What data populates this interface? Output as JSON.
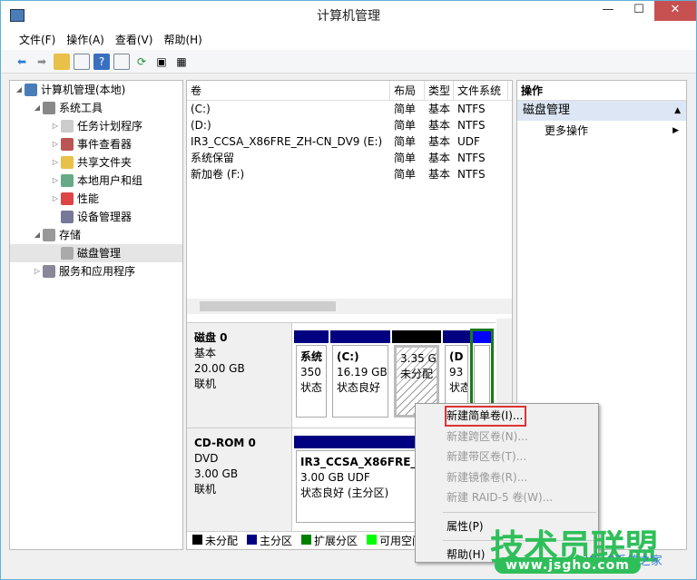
{
  "window": {
    "title": "计算机管理",
    "min": "—",
    "max": "☐",
    "close": "✕"
  },
  "menu": [
    "文件(F)",
    "操作(A)",
    "查看(V)",
    "帮助(H)"
  ],
  "tree": [
    {
      "label": "计算机管理(本地)",
      "level": 0,
      "tw": "◢",
      "color": "#4a7db8"
    },
    {
      "label": "系统工具",
      "level": 1,
      "tw": "◢",
      "color": "#888"
    },
    {
      "label": "任务计划程序",
      "level": 2,
      "tw": "▷",
      "color": "#ccc"
    },
    {
      "label": "事件查看器",
      "level": 2,
      "tw": "▷",
      "color": "#b55"
    },
    {
      "label": "共享文件夹",
      "level": 2,
      "tw": "▷",
      "color": "#e8c04a"
    },
    {
      "label": "本地用户和组",
      "level": 2,
      "tw": "▷",
      "color": "#6a8"
    },
    {
      "label": "性能",
      "level": 2,
      "tw": "▷",
      "color": "#d44"
    },
    {
      "label": "设备管理器",
      "level": 2,
      "tw": "",
      "color": "#779"
    },
    {
      "label": "存储",
      "level": 1,
      "tw": "◢",
      "color": "#999"
    },
    {
      "label": "磁盘管理",
      "level": 2,
      "tw": "",
      "color": "#aaa",
      "selected": true
    },
    {
      "label": "服务和应用程序",
      "level": 1,
      "tw": "▷",
      "color": "#889"
    }
  ],
  "volumes": {
    "headers": [
      "卷",
      "布局",
      "类型",
      "文件系统"
    ],
    "rows": [
      [
        "(C:)",
        "简单",
        "基本",
        "NTFS"
      ],
      [
        "(D:)",
        "简单",
        "基本",
        "NTFS"
      ],
      [
        "IR3_CCSA_X86FRE_ZH-CN_DV9 (E:)",
        "简单",
        "基本",
        "UDF"
      ],
      [
        "系统保留",
        "简单",
        "基本",
        "NTFS"
      ],
      [
        "新加卷 (F:)",
        "简单",
        "基本",
        "NTFS"
      ]
    ]
  },
  "disk0": {
    "name": "磁盘 0",
    "type": "基本",
    "size": "20.00 GB",
    "status": "联机",
    "parts": [
      {
        "l1": "系统",
        "l2": "350",
        "l3": "状态",
        "color": "#000080"
      },
      {
        "l1": "(C:)",
        "l2": "16.19 GB",
        "l3": "状态良好",
        "color": "#000080"
      },
      {
        "l1": "",
        "l2": "3.35 GB",
        "l3": "未分配",
        "color": "#000000"
      },
      {
        "l1": "(D",
        "l2": "93",
        "l3": "状态",
        "color": "#000080"
      },
      {
        "l1": "",
        "l2": "",
        "l3": "",
        "color": "#0000ff"
      }
    ]
  },
  "cdrom": {
    "name": "CD-ROM 0",
    "type": "DVD",
    "size": "3.00 GB",
    "status": "联机",
    "l1": "IR3_CCSA_X86FRE_ZH",
    "l2": "3.00 GB UDF",
    "l3": "状态良好 (主分区)",
    "color": "#000080"
  },
  "legend": [
    {
      "label": "未分配",
      "color": "#000000"
    },
    {
      "label": "主分区",
      "color": "#000080"
    },
    {
      "label": "扩展分区",
      "color": "#008000"
    },
    {
      "label": "可用空间",
      "color": "#00ff00"
    }
  ],
  "actions": {
    "header": "操作",
    "section": "磁盘管理",
    "more": "更多操作"
  },
  "context_menu": [
    "新建简单卷(I)...",
    "新建跨区卷(N)...",
    "新建带区卷(T)...",
    "新建镜像卷(R)...",
    "新建 RAID-5 卷(W)...",
    "属性(P)",
    "帮助(H)"
  ],
  "watermark": {
    "main": "技术员联盟",
    "url": "www.jsgho.com",
    "sub": "Win8系统之家"
  }
}
